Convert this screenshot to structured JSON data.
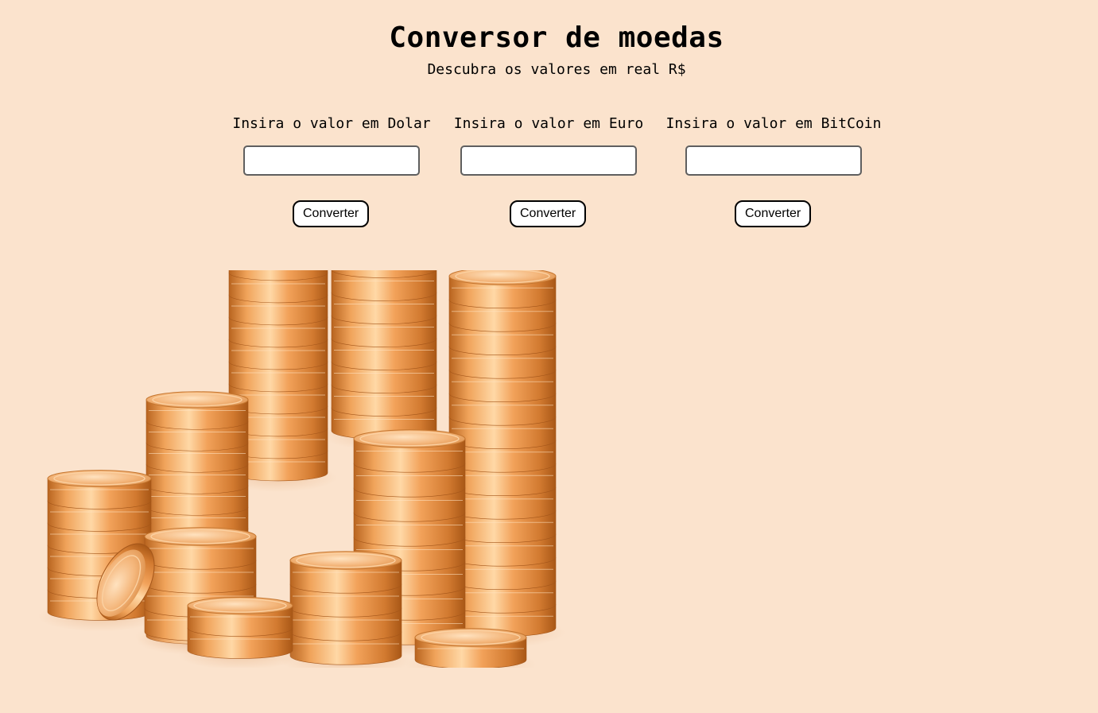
{
  "header": {
    "title": "Conversor de moedas",
    "subtitle": "Descubra os valores em real R$"
  },
  "converters": [
    {
      "label": "Insira o valor em Dolar",
      "input_value": "",
      "button_label": "Converter"
    },
    {
      "label": "Insira o valor em Euro",
      "input_value": "",
      "button_label": "Converter"
    },
    {
      "label": "Insira o valor em BitCoin",
      "input_value": "",
      "button_label": "Converter"
    }
  ],
  "colors": {
    "background": "#fbe3cd",
    "coin": "#e8954a",
    "button_border": "#000000",
    "input_border": "#5f5f5f"
  },
  "image": {
    "icon": "gold-coins-stacks"
  }
}
